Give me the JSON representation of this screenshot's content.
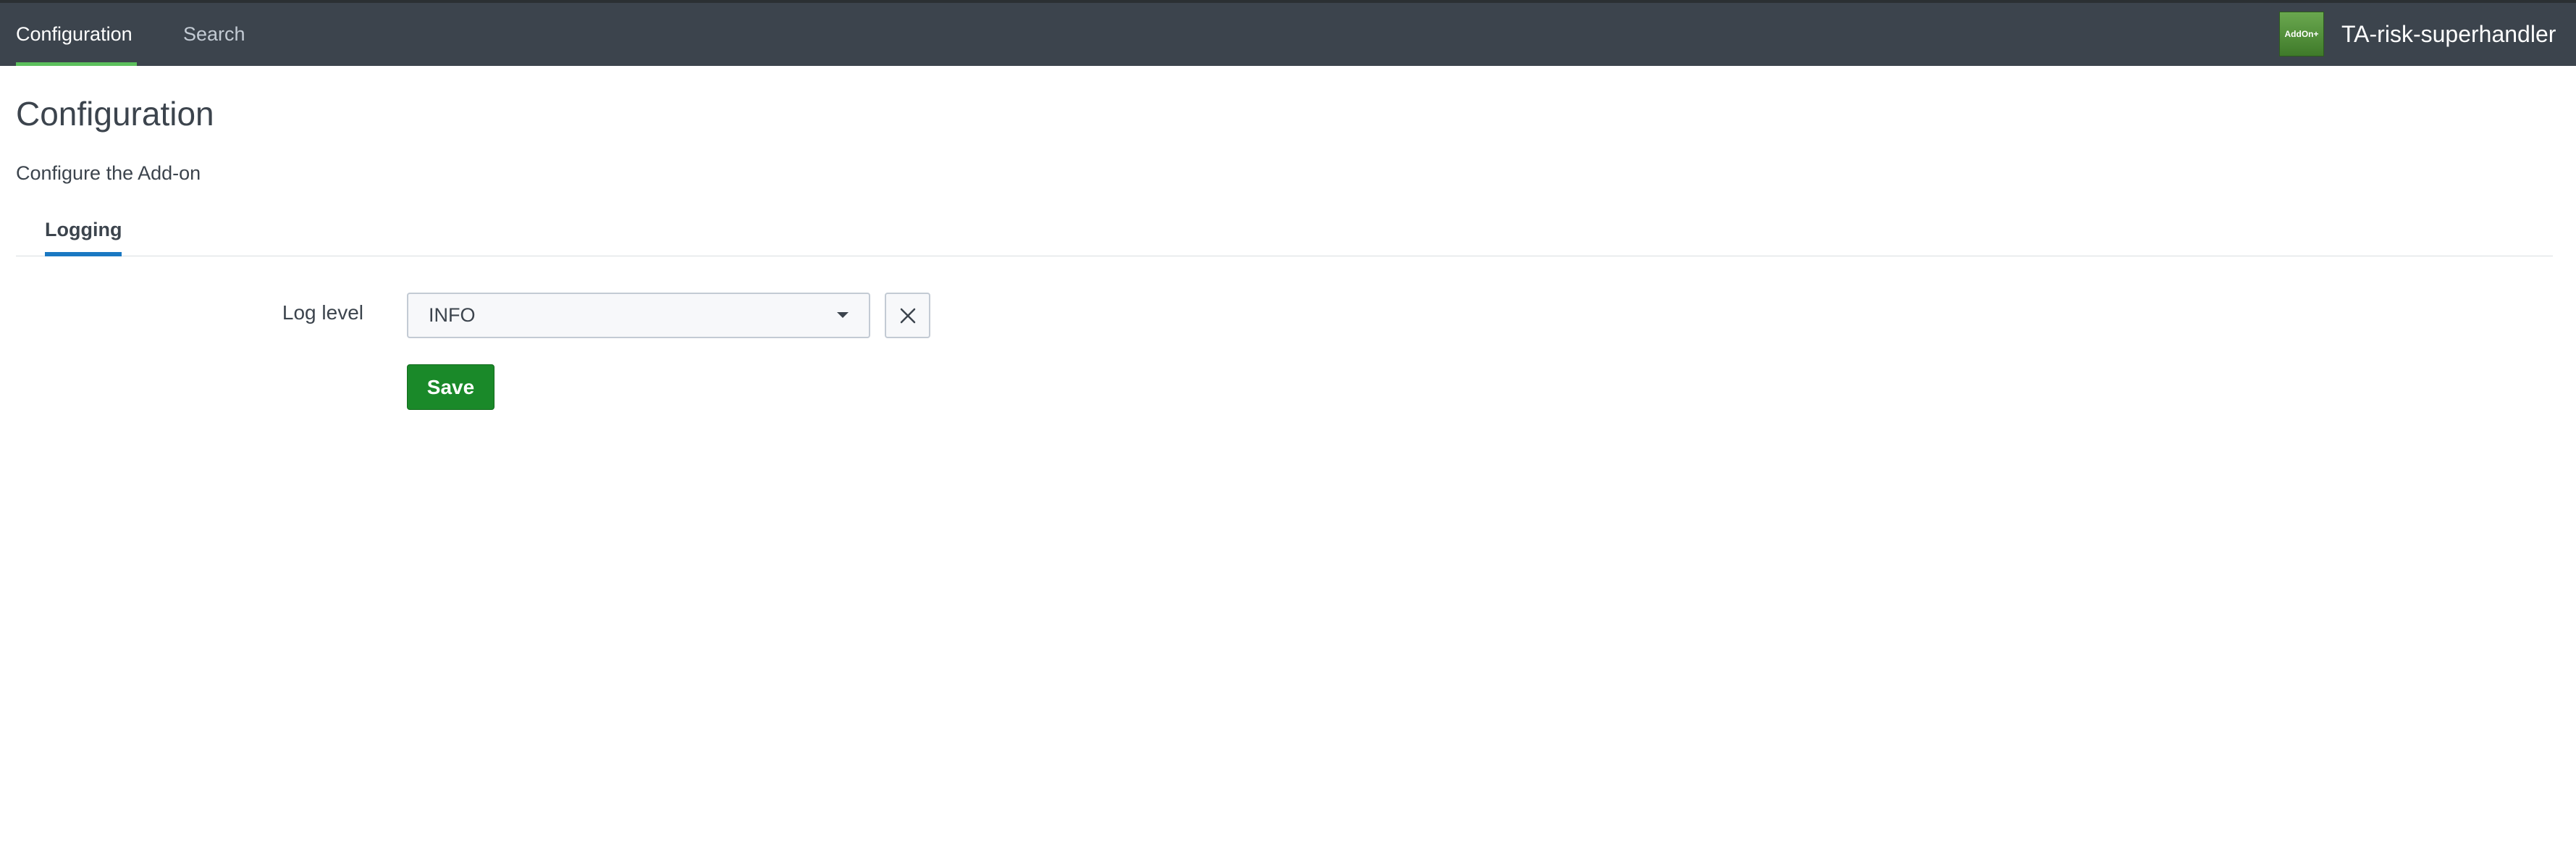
{
  "nav": {
    "items": [
      {
        "label": "Configuration",
        "active": true
      },
      {
        "label": "Search",
        "active": false
      }
    ]
  },
  "app": {
    "badge_text": "AddOn+",
    "name": "TA-risk-superhandler",
    "badge_color": "#4e8f36"
  },
  "page": {
    "title": "Configuration",
    "description": "Configure the Add-on"
  },
  "tabs": [
    {
      "label": "Logging",
      "active": true
    }
  ],
  "form": {
    "log_level_label": "Log level",
    "log_level_value": "INFO",
    "clear_icon": "close-icon",
    "dropdown_icon": "caret-down-icon",
    "save_label": "Save"
  },
  "colors": {
    "topbar": "#3c444d",
    "nav_active_underline": "#5cc05c",
    "tab_active_underline": "#1a78c2",
    "save_button": "#1a8929"
  }
}
